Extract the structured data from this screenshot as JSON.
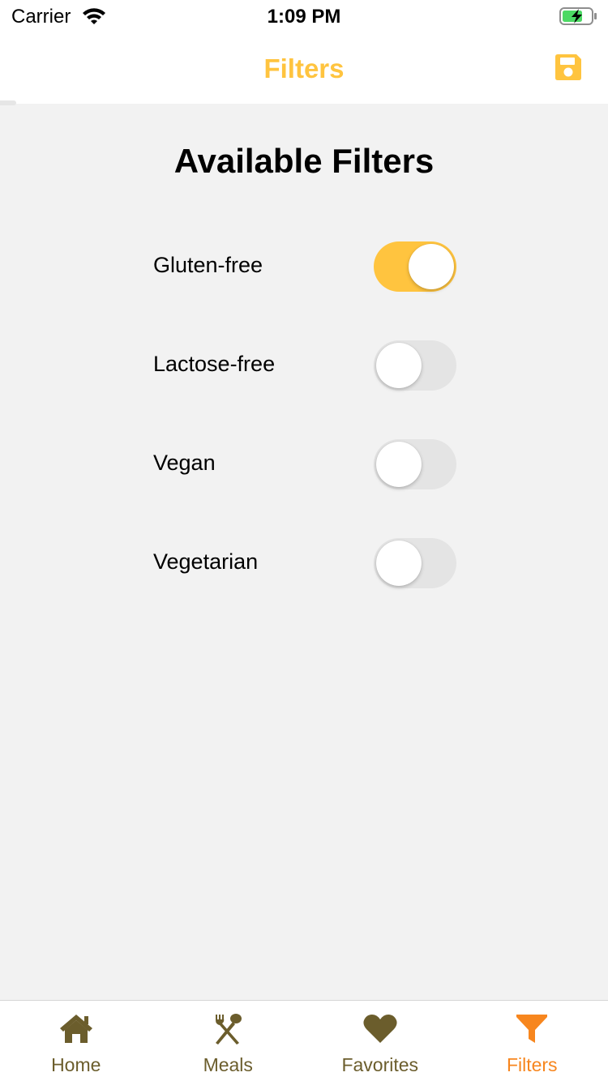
{
  "status_bar": {
    "carrier": "Carrier",
    "time": "1:09 PM"
  },
  "nav": {
    "title": "Filters",
    "save_icon": "floppy-disk-icon",
    "accent_color": "#ffc43f"
  },
  "page": {
    "title": "Available Filters"
  },
  "filters": [
    {
      "label": "Gluten-free",
      "enabled": true
    },
    {
      "label": "Lactose-free",
      "enabled": false
    },
    {
      "label": "Vegan",
      "enabled": false
    },
    {
      "label": "Vegetarian",
      "enabled": false
    }
  ],
  "tabs": [
    {
      "label": "Home",
      "icon": "home-icon",
      "active": false
    },
    {
      "label": "Meals",
      "icon": "utensils-icon",
      "active": false
    },
    {
      "label": "Favorites",
      "icon": "heart-icon",
      "active": false
    },
    {
      "label": "Filters",
      "icon": "funnel-icon",
      "active": true
    }
  ],
  "colors": {
    "tab_inactive": "#6b5d2c",
    "tab_active": "#f7861e",
    "toggle_on": "#ffc43f",
    "toggle_off": "#e4e4e4"
  }
}
